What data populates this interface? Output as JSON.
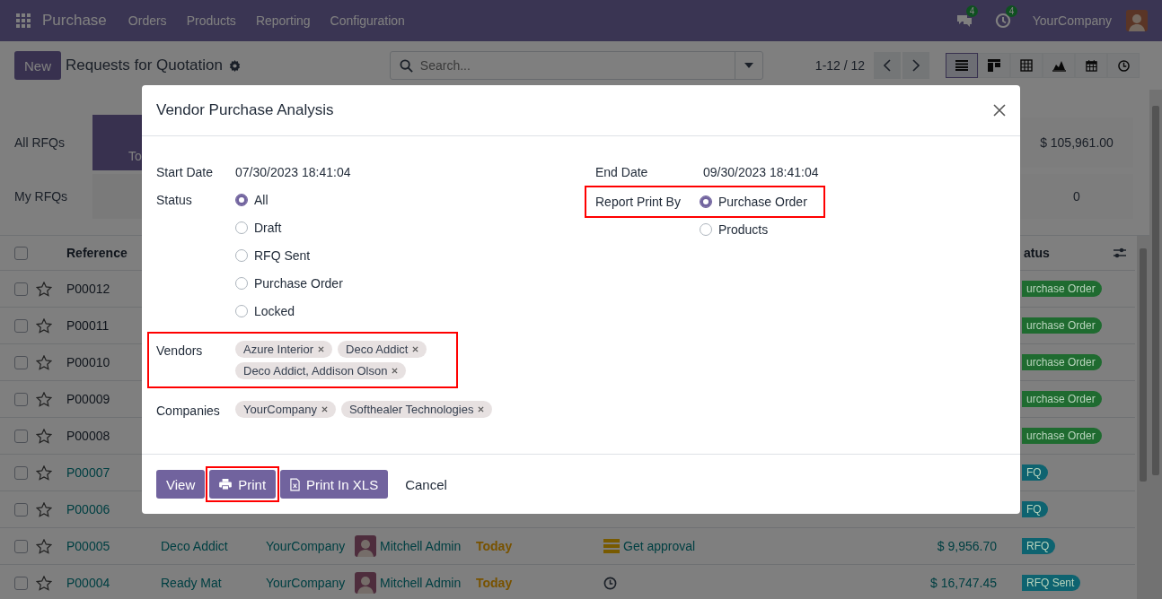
{
  "navbar": {
    "app": "Purchase",
    "menus": [
      "Orders",
      "Products",
      "Reporting",
      "Configuration"
    ],
    "messages_count": "4",
    "activities_count": "4",
    "company": "YourCompany"
  },
  "control_panel": {
    "new_button": "New",
    "title": "Requests for Quotation",
    "search": {
      "placeholder": "Search..."
    },
    "pager": "1-12 / 12",
    "views": [
      {
        "kind": "list",
        "selected": true
      },
      {
        "kind": "kanban",
        "selected": false
      },
      {
        "kind": "pivot",
        "selected": false
      },
      {
        "kind": "graph",
        "selected": false
      },
      {
        "kind": "calendar",
        "selected": false
      },
      {
        "kind": "activity",
        "selected": false
      }
    ]
  },
  "dashboard": {
    "row_labels": [
      "All RFQs",
      "My RFQs"
    ],
    "tile_label": "To",
    "totals": [
      "$ 105,961.00",
      "0"
    ]
  },
  "table": {
    "columns": [
      "Reference",
      "atus"
    ],
    "header_checked": false,
    "rows": [
      {
        "reference": "P00012",
        "kind": "order",
        "checked": false,
        "starred": false,
        "status": "urchase Order",
        "color": "#1f6b30"
      },
      {
        "reference": "P00011",
        "kind": "order",
        "checked": false,
        "starred": false,
        "status": "urchase Order",
        "color": "#1f6b30"
      },
      {
        "reference": "P00010",
        "kind": "order",
        "checked": false,
        "starred": false,
        "status": "urchase Order",
        "color": "#1f6b30"
      },
      {
        "reference": "P00009",
        "kind": "order",
        "checked": false,
        "starred": false,
        "status": "urchase Order",
        "color": "#1f6b30"
      },
      {
        "reference": "P00008",
        "kind": "order",
        "checked": false,
        "starred": false,
        "status": "urchase Order",
        "color": "#1f6b30"
      },
      {
        "reference": "P00007",
        "kind": "rfq",
        "checked": false,
        "starred": false,
        "status": "FQ",
        "color": "#0e6370"
      },
      {
        "reference": "P00006",
        "kind": "rfq",
        "checked": false,
        "starred": false,
        "status": "FQ",
        "color": "#0e6370"
      },
      {
        "reference": "P00005",
        "kind": "rfq",
        "checked": false,
        "starred": false,
        "vendor": "Deco Addict",
        "company": "YourCompany",
        "user": "Mitchell Admin",
        "deadline": "Today",
        "activity": {
          "kind": "approval",
          "text": "Get approval"
        },
        "total": "$ 9,956.70",
        "status": "RFQ",
        "color": "#0e6370"
      },
      {
        "reference": "P00004",
        "kind": "rfq",
        "checked": false,
        "starred": false,
        "vendor": "Ready Mat",
        "company": "YourCompany",
        "user": "Mitchell Admin",
        "deadline": "Today",
        "activity": {
          "kind": "clock"
        },
        "total": "$ 16,747.45",
        "status": "RFQ Sent",
        "color": "#0e6370"
      }
    ]
  },
  "dialog": {
    "title": "Vendor Purchase Analysis",
    "start_date": {
      "label": "Start Date",
      "value": "07/30/2023 18:41:04"
    },
    "end_date": {
      "label": "End Date",
      "value": "09/30/2023 18:41:04"
    },
    "status": {
      "label": "Status",
      "options": [
        {
          "label": "All",
          "selected": true
        },
        {
          "label": "Draft",
          "selected": false
        },
        {
          "label": "RFQ Sent",
          "selected": false
        },
        {
          "label": "Purchase Order",
          "selected": false
        },
        {
          "label": "Locked",
          "selected": false
        }
      ]
    },
    "report_print_by": {
      "label": "Report Print By",
      "highlighted": true,
      "options": [
        {
          "label": "Purchase Order",
          "selected": true
        },
        {
          "label": "Products",
          "selected": false
        }
      ]
    },
    "vendors": {
      "label": "Vendors",
      "highlighted": true,
      "tags": [
        "Azure Interior",
        "Deco Addict",
        "Deco Addict, Addison Olson"
      ]
    },
    "companies": {
      "label": "Companies",
      "highlighted": false,
      "tags": [
        "YourCompany",
        "Softhealer Technologies"
      ]
    },
    "buttons": [
      {
        "label": "View",
        "kind": "view",
        "highlighted": false
      },
      {
        "label": "Print",
        "kind": "print",
        "highlighted": true
      },
      {
        "label": "Print In XLS",
        "kind": "print_xls",
        "highlighted": false
      },
      {
        "label": "Cancel",
        "kind": "cancel",
        "highlighted": false
      }
    ]
  }
}
